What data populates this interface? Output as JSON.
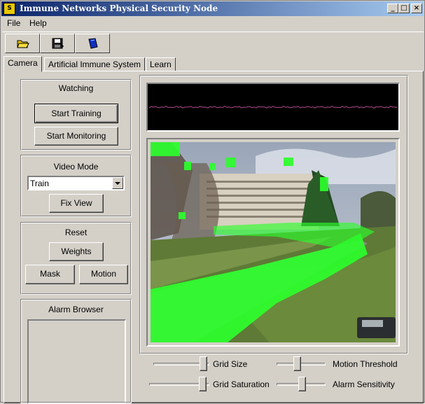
{
  "window": {
    "title": "Immune Networks Physical Security Node",
    "logo_text": "S",
    "controls": [
      "_",
      "□",
      "×"
    ]
  },
  "menu": [
    "File",
    "Help"
  ],
  "toolbar": {
    "icons": [
      "open-folder-icon",
      "save-disk-icon",
      "book-icon"
    ]
  },
  "tabs": [
    "Camera",
    "Artificial Immune System",
    "Learn"
  ],
  "active_tab": "Camera",
  "status_group": {
    "label": "Watching",
    "start_training": "Start Training",
    "start_monitoring": "Start Monitoring"
  },
  "video_mode_group": {
    "label": "Video Mode",
    "selected": "Train",
    "fix_view": "Fix View"
  },
  "reset_group": {
    "label": "Reset",
    "weights": "Weights",
    "mask": "Mask",
    "motion": "Motion"
  },
  "alarm_browser": {
    "label": "Alarm Browser"
  },
  "sliders": {
    "grid_size": "Grid Size",
    "grid_saturation": "Grid Saturation",
    "motion_threshold": "Motion Threshold",
    "alarm_sensitivity": "Alarm Sensitivity",
    "grid_size_value": 0.95,
    "grid_saturation_value": 0.95,
    "motion_threshold_value": 0.4,
    "alarm_sensitivity_value": 0.52
  },
  "colors": {
    "title_bar_start": "#0a246a",
    "title_bar_end": "#a6caf0",
    "face": "#d4d0c8",
    "scope_background": "#000000",
    "scope_trace": "#b04a8c",
    "motion_overlay": "#2cff2c"
  }
}
